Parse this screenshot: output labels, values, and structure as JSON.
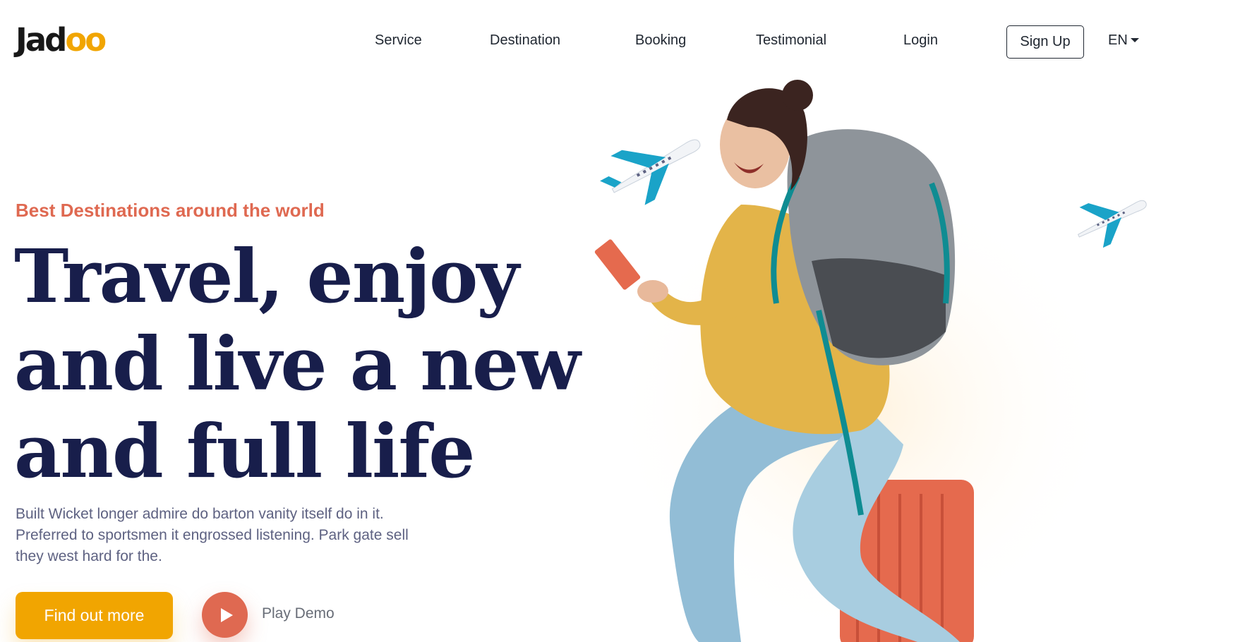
{
  "brand": {
    "logo_main": "Jad",
    "logo_accent": "oo"
  },
  "nav": {
    "items": [
      "Service",
      "Destination",
      "Booking",
      "Testimonial",
      "Login"
    ],
    "signup": "Sign Up",
    "language": "EN"
  },
  "hero": {
    "eyebrow": "Best Destinations around the world",
    "headline": {
      "line1_a": "Travel,",
      "line1_b": "enjoy",
      "line2": "and live a new",
      "line3": "and full life"
    },
    "description": "Built Wicket longer admire do barton vanity itself do in it. Preferred to sportsmen it engrossed listening. Park gate sell they west hard for the.",
    "cta": "Find out more",
    "play": "Play Demo"
  },
  "colors": {
    "primary_dark": "#181E4B",
    "accent_orange": "#DF6951",
    "accent_yellow": "#F1A501",
    "body_text": "#5E6282"
  },
  "icons": [
    "caret-down-icon",
    "play-icon",
    "airplane-icon"
  ]
}
